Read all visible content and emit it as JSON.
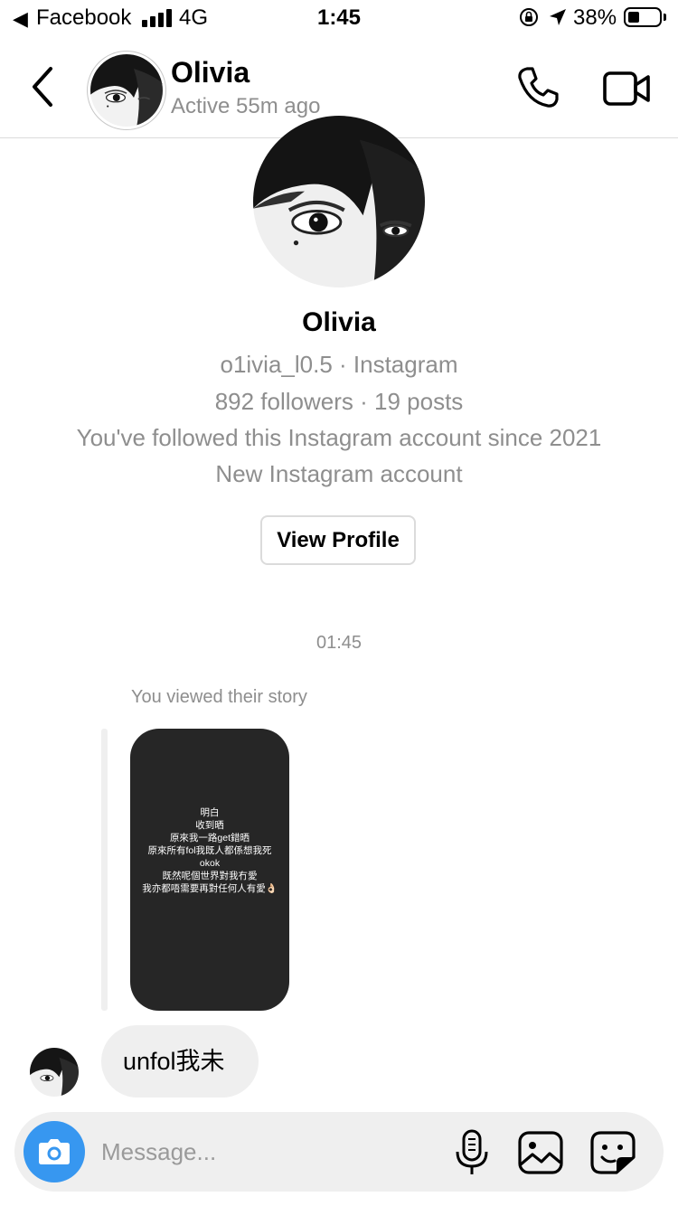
{
  "status_bar": {
    "back_glyph": "◀",
    "app": "Facebook",
    "network": "4G",
    "time": "1:45",
    "battery": "38%",
    "battery_level": 0.38
  },
  "header": {
    "name": "Olivia",
    "status": "Active 55m ago",
    "icons": [
      "chevron-left-icon",
      "phone-icon",
      "video-camera-icon"
    ]
  },
  "profile": {
    "name": "Olivia",
    "handle_line": "o1ivia_l0.5 · Instagram",
    "stats_line": "892 followers · 19 posts",
    "follow_line": "You've followed this Instagram account since 2021",
    "new_line": "New Instagram account",
    "button": "View Profile"
  },
  "thread": {
    "timestamp": "01:45",
    "story_note": "You viewed their story",
    "story_lines": [
      "明白",
      "收到晒",
      "原來我一路get錯晒",
      "原來所有fol我既人都係想我死",
      "okok",
      "既然呢個世界對我冇愛",
      "我亦都唔需要再對任何人有愛👌🏻"
    ],
    "message": "unfol我未"
  },
  "composer": {
    "placeholder": "Message...",
    "icons": [
      "camera-icon",
      "microphone-icon",
      "gallery-icon",
      "sticker-icon"
    ]
  },
  "colors": {
    "accent": "#3797f0",
    "secondary_text": "#8e8e8e",
    "bubble": "#efefef",
    "story_bg": "#262626"
  }
}
